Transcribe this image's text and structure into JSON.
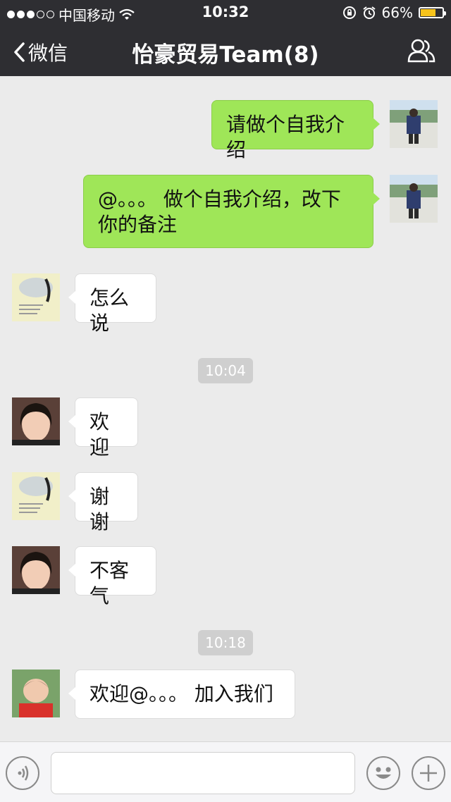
{
  "status_bar": {
    "carrier": "中国移动",
    "time": "10:32",
    "battery": "66%",
    "battery_level": 0.66
  },
  "nav": {
    "back_label": "微信",
    "title": "怡豪贸易Team(8)"
  },
  "messages": [
    {
      "text": "请做个自我介绍"
    },
    {
      "text": "@。。。 做个自我介绍，改下你的备注"
    },
    {
      "text": "怎么说"
    },
    {
      "text": "欢迎"
    },
    {
      "text": "谢谢"
    },
    {
      "text": "不客气"
    },
    {
      "text": "欢迎@。。。 加入我们"
    }
  ],
  "timestamps": [
    "10:04",
    "10:18"
  ],
  "input": {
    "value": ""
  },
  "colors": {
    "nav_bg": "#2e2e32",
    "chat_bg": "#ebebeb",
    "outgoing_bubble": "#9fe658",
    "incoming_bubble": "#ffffff",
    "battery_fill": "#f7c31b"
  },
  "icons": {
    "back": "chevron-left-icon",
    "members": "group-members-icon",
    "voice": "voice-icon",
    "emoji": "emoji-icon",
    "more": "plus-icon"
  }
}
